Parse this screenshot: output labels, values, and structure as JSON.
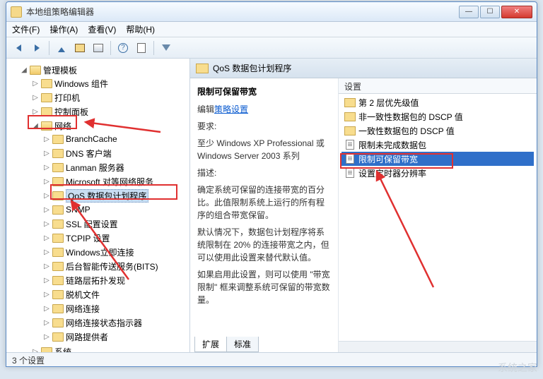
{
  "window": {
    "title": "本地组策略编辑器"
  },
  "menu": {
    "file": "文件(F)",
    "action": "操作(A)",
    "view": "查看(V)",
    "help": "帮助(H)"
  },
  "tree": {
    "root": "管理模板",
    "items": [
      "Windows 组件",
      "打印机",
      "控制面板"
    ],
    "network": "网络",
    "network_children": [
      "BranchCache",
      "DNS 客户端",
      "Lanman 服务器",
      "Microsoft 对等网络服务",
      "QoS 数据包计划程序",
      "SNMP",
      "SSL 配置设置",
      "TCPIP 设置",
      "Windows立即连接",
      "后台智能传送服务(BITS)",
      "链路层拓扑发现",
      "脱机文件",
      "网络连接",
      "网络连接状态指示器",
      "网路提供者"
    ],
    "system": "系统"
  },
  "detail": {
    "header": "QoS 数据包计划程序",
    "title": "限制可保留带宽",
    "edit_prefix": "编辑",
    "edit_link": "策略设置",
    "req_label": "要求:",
    "req_text": "至少 Windows XP Professional 或 Windows Server 2003 系列",
    "desc_label": "描述:",
    "desc1": "确定系统可保留的连接带宽的百分比。此值限制系统上运行的所有程序的组合带宽保留。",
    "desc2": "默认情况下，数据包计划程序将系统限制在 20% 的连接带宽之内，但可以使用此设置来替代默认值。",
    "desc3": "如果启用此设置，则可以使用 \"带宽限制\" 框来调整系统可保留的带宽数量。",
    "col_header": "设置",
    "settings": [
      "第 2 层优先级值",
      "非一致性数据包的 DSCP 值",
      "一致性数据包的 DSCP 值",
      "限制未完成数据包",
      "限制可保留带宽",
      "设置定时器分辨率"
    ],
    "tab_ext": "扩展",
    "tab_std": "标准"
  },
  "status": "3 个设置",
  "watermark": "系统之家"
}
